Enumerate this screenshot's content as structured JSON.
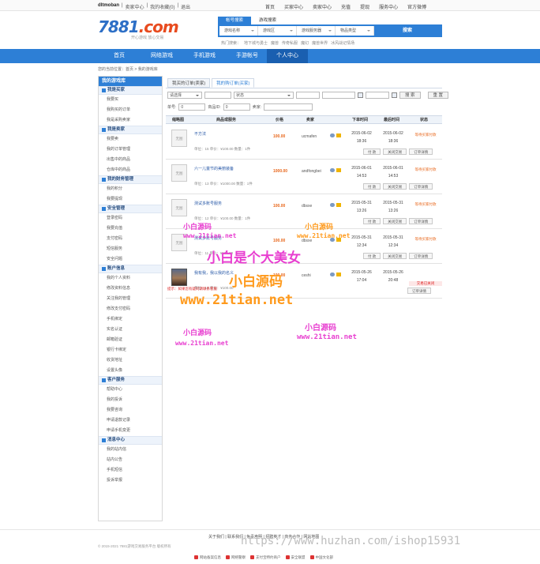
{
  "topbar": {
    "user": "dltmoban",
    "links": [
      "卖家中心",
      "我的收藏(0)",
      "退出"
    ],
    "right": [
      "首页",
      "买家中心",
      "卖家中心",
      "充值",
      "提现",
      "服务中心",
      "官方微博"
    ]
  },
  "logo": {
    "number": "7881",
    "suffix": ".com",
    "slogan": "开心游戏 放心交易"
  },
  "search": {
    "tabs": [
      "帐号搜索",
      "游戏搜索"
    ],
    "fields": [
      "游戏名称",
      "游戏区",
      "游戏服务器",
      "物品类型"
    ],
    "button": "搜索",
    "hotwords": [
      "热门搜索：",
      "地下城与勇士",
      "魔兽",
      "传奇私服",
      "魔幻",
      "魔兽世界",
      "冰风战记情场"
    ]
  },
  "nav": [
    "首页",
    "网络游戏",
    "手机游戏",
    "手游帐号",
    "个人中心"
  ],
  "breadcrumb": "您的当前位置：首页 > 我的游戏库",
  "sidebar": {
    "title": "我的游戏库",
    "groups": [
      {
        "title": "我是买家",
        "items": [
          "我要买",
          "我购买的订单",
          "我是采购卖家"
        ]
      },
      {
        "title": "我是卖家",
        "items": [
          "我要卖",
          "我的订单管理",
          "出售中的商品",
          "仓库中的商品"
        ]
      },
      {
        "title": "我的财务管理",
        "items": [
          "我的积分",
          "我要提现"
        ]
      },
      {
        "title": "安全管理",
        "items": [
          "登录密码",
          "我要充值",
          "支付密码",
          "短信服务",
          "安全问题"
        ]
      },
      {
        "title": "账户信息",
        "items": [
          "我的个人资料",
          "修改资料信息",
          "关注我的管理",
          "修改支付密码",
          "手机绑定",
          "实名认证",
          "邮箱验证",
          "银行卡绑定",
          "收货地址",
          "设置头像"
        ]
      },
      {
        "title": "客户服务",
        "items": [
          "帮助中心",
          "我的投诉",
          "我要咨询",
          "申请退款记录",
          "申请手机变更"
        ]
      },
      {
        "title": "消息中心",
        "items": [
          "我的站内信",
          "站内公告",
          "手机短信",
          "投诉举报"
        ]
      }
    ]
  },
  "tabs": [
    "我买的订单(卖家)",
    "我的购订单(买家)"
  ],
  "filters": {
    "row1": {
      "sel1": "请选择",
      "sel2": "状态",
      "button1": "搜 索",
      "button2": "重 置"
    },
    "row2": {
      "label1": "单号:",
      "val1": "0",
      "label2": "商品ID:",
      "val2": "0",
      "label3": "卖家:"
    }
  },
  "table": {
    "headers": [
      "缩略图",
      "商品或服务",
      "价格",
      "卖家",
      "下单时间",
      "最后时间",
      "状态"
    ],
    "rows": [
      {
        "thumb": "无图",
        "name": "不方法",
        "sub": "",
        "meta": "单位：15  单价：¥100.00  数量：1件",
        "price": "100.00",
        "seller": "ucmafen",
        "t1a": "2015-06-02",
        "t1b": "18:36",
        "t2a": "2015-06-02",
        "t2b": "18:36",
        "status": "等待买家付款",
        "status2": "",
        "btns": [
          "付 款",
          "关闭交易",
          "订单详情"
        ]
      },
      {
        "thumb": "无图",
        "name": "六一儿童节的美丽装备",
        "sub": "",
        "meta": "单位：13  单价：¥1000.00  数量：1件",
        "price": "1000.00",
        "seller": "andfongbei",
        "t1a": "2015-06-01",
        "t1b": "14:53",
        "t2a": "2015-06-01",
        "t2b": "14:53",
        "status": "等待买家付款",
        "status2": "",
        "btns": [
          "付 款",
          "关闭交易",
          "订单详情"
        ]
      },
      {
        "thumb": "无图",
        "name": "测试多账号服务",
        "sub": "",
        "meta": "单位：12  单价：¥100.00  数量：1件",
        "price": "100.00",
        "seller": "dbsxe",
        "t1a": "2015-05-31",
        "t1b": "13:26",
        "t2a": "2015-05-31",
        "t2b": "13:26",
        "status": "等待买家付款",
        "status2": "",
        "btns": [
          "付 款",
          "关闭交易",
          "订单详情"
        ]
      },
      {
        "thumb": "无图",
        "name": "测试多账号服务",
        "sub": "",
        "meta": "单位：11  单价：¥100.00",
        "price": "100.00",
        "seller": "dbsxe",
        "t1a": "2015-05-31",
        "t1b": "12:34",
        "t2a": "2015-05-31",
        "t2b": "12:34",
        "status": "等待买家付款",
        "status2": "",
        "btns": [
          "付 款",
          "关闭交易",
          "订单详情"
        ]
      },
      {
        "thumb": "",
        "name": "我有我，我以我的名义",
        "sub": "",
        "meta": "单位：10  单价：¥100.00",
        "price": "100.00",
        "seller": "ceshi",
        "t1a": "2015-05-26",
        "t1b": "17:04",
        "t2a": "2015-05-26",
        "t2b": "20:48",
        "status": "",
        "status2": "交易已关闭",
        "btns": [
          "订单详情"
        ]
      }
    ],
    "notice": "提示：如果您有疑问请联系客服"
  },
  "watermarks": {
    "brand": "小白源码",
    "site": "www.21tian.net",
    "slogan": "小白是个大美女"
  },
  "footer": {
    "links": "关于我们 | 联系我们 | 免责声明 | 招聘英才 | 商务合作 | 网站地图",
    "copy": "© 2015-2021 7881游戏交易服务平台 版权所有",
    "certs": [
      "网站备案信息",
      "网络警察",
      "支付宝特约商户",
      "安全联盟",
      "中国文化部"
    ]
  },
  "overlay_url": "https://www.huzhan.com/ishop15931"
}
